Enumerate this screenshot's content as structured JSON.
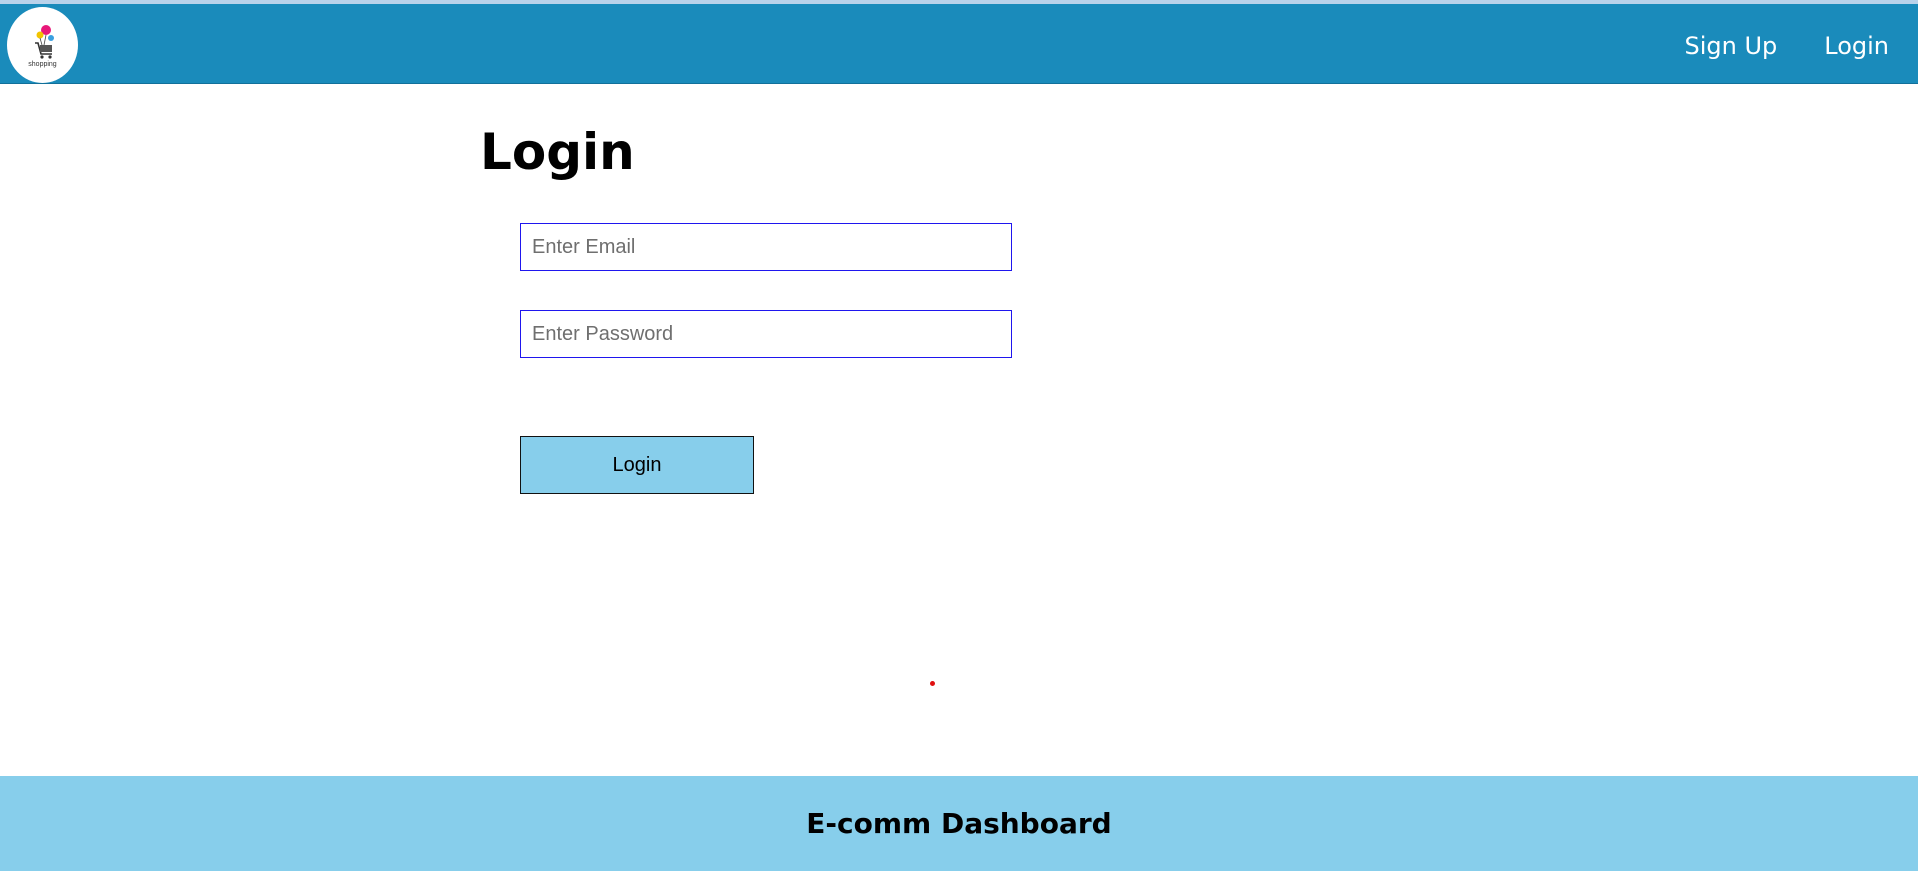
{
  "brand": {
    "logo_text": "shopping",
    "colors": {
      "nav_bg": "#1a8bbb",
      "footer_bg": "#87ceeb",
      "button_bg": "#87ceeb",
      "input_border": "#1f16ee"
    }
  },
  "nav": {
    "items": [
      {
        "label": "Sign Up"
      },
      {
        "label": "Login"
      }
    ]
  },
  "main": {
    "title": "Login",
    "email": {
      "placeholder": "Enter Email",
      "value": ""
    },
    "password": {
      "placeholder": "Enter Password",
      "value": ""
    },
    "submit_label": "Login"
  },
  "footer": {
    "title": "E-comm Dashboard"
  }
}
